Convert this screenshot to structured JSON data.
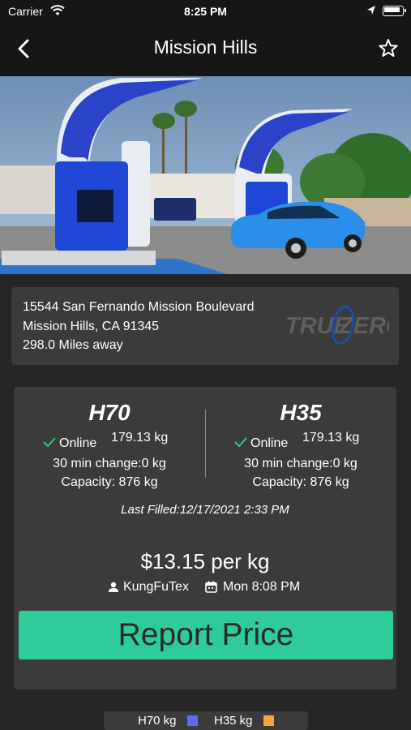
{
  "status_bar": {
    "carrier": "Carrier",
    "time": "8:25 PM"
  },
  "nav": {
    "title": "Mission Hills"
  },
  "station": {
    "address_line1": "15544 San Fernando Mission Boulevard",
    "address_line2": "Mission Hills, CA 91345",
    "distance": "298.0 Miles away",
    "brand_logo": "TRUE ZERO",
    "brand_logo_left": "TRUE",
    "brand_logo_right": "ZERO"
  },
  "h70": {
    "label": "H70",
    "status": "Online",
    "amount": "179.13 kg",
    "change": "30 min change:0 kg",
    "capacity": "Capacity: 876 kg"
  },
  "h35": {
    "label": "H35",
    "status": "Online",
    "amount": "179.13 kg",
    "change": "30 min change:0 kg",
    "capacity": "Capacity: 876 kg"
  },
  "last_filled": "Last Filled:12/17/2021 2:33 PM",
  "price": {
    "text": "$13.15 per kg",
    "reporter": "KungFuTex",
    "reported_at": "Mon 8:08 PM"
  },
  "report_button": "Report Price",
  "legend": {
    "h70_label": "H70 kg",
    "h35_label": "H35 kg",
    "h70_color": "#5b6cf0",
    "h35_color": "#f5a540"
  },
  "colors": {
    "accent": "#2ecc9a",
    "background": "#262626",
    "card": "#3b3b3b"
  },
  "icons": [
    "wifi-icon",
    "location-arrow-icon",
    "battery-icon",
    "back-chevron-icon",
    "star-icon",
    "checkmark-icon",
    "user-icon",
    "calendar-icon"
  ]
}
